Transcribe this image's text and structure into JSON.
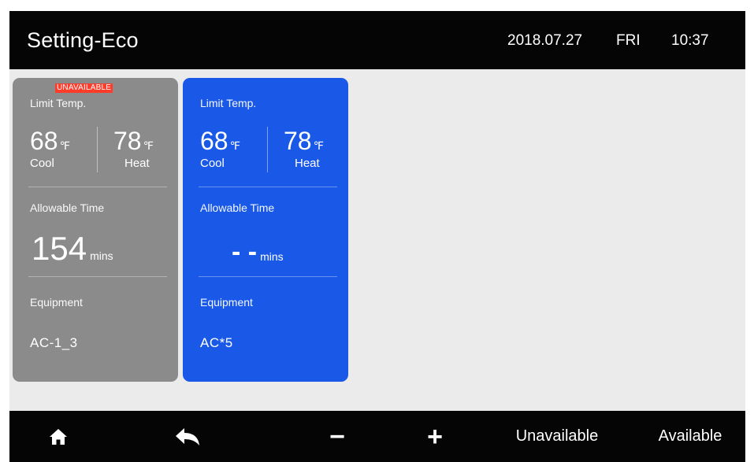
{
  "header": {
    "title": "Setting-Eco",
    "date": "2018.07.27",
    "day": "FRI",
    "time": "10:37"
  },
  "cards": [
    {
      "status_badge": "UNAVAILABLE",
      "limit_label": "Limit Temp.",
      "cool_value": "68",
      "cool_unit": "℉",
      "cool_label": "Cool",
      "heat_value": "78",
      "heat_unit": "℉",
      "heat_label": "Heat",
      "time_label": "Allowable Time",
      "time_value": "154",
      "time_unit": "mins",
      "equipment_label": "Equipment",
      "equipment_value": "AC-1_3",
      "color": "#8b8b8b"
    },
    {
      "limit_label": "Limit Temp.",
      "cool_value": "68",
      "cool_unit": "℉",
      "cool_label": "Cool",
      "heat_value": "78",
      "heat_unit": "℉",
      "heat_label": "Heat",
      "time_label": "Allowable Time",
      "time_value": "- -",
      "time_unit": "mins",
      "equipment_label": "Equipment",
      "equipment_value": "AC*5",
      "color": "#1a59e8"
    }
  ],
  "bottom_bar": {
    "home_icon": "home-icon",
    "back_icon": "back-arrow-icon",
    "minus_glyph": "−",
    "plus_glyph": "+",
    "unavailable_label": "Unavailable",
    "available_label": "Available"
  },
  "colors": {
    "bar_background": "#050505",
    "screen_background": "#ebebeb",
    "badge_red": "#ff3b2a"
  }
}
